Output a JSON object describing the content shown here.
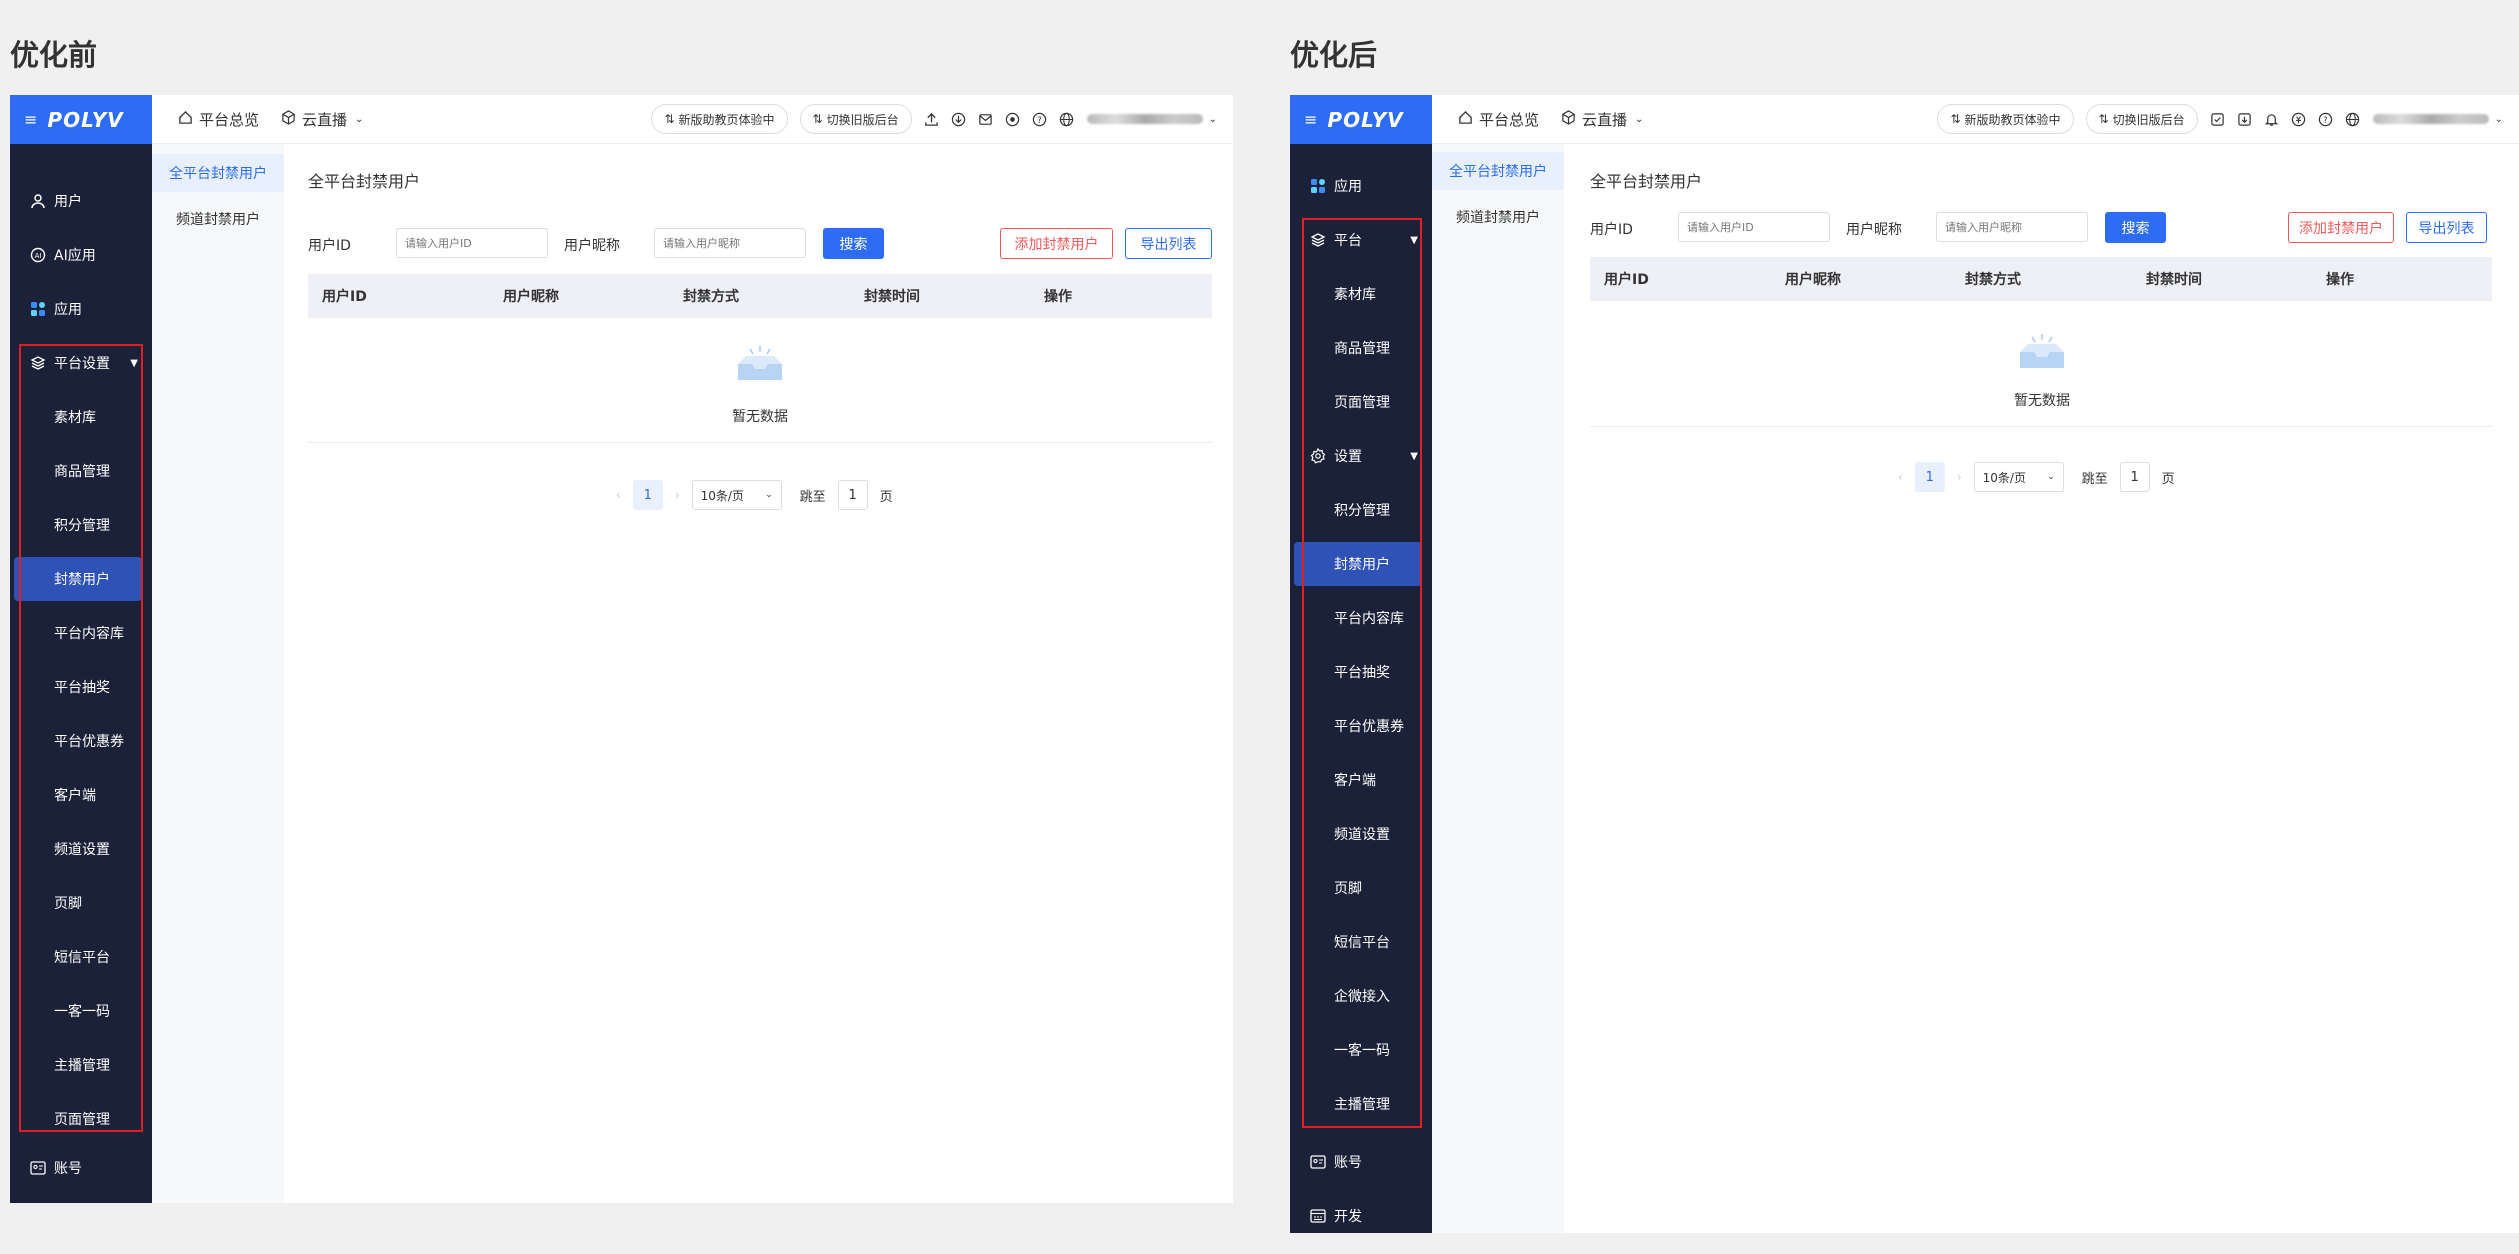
{
  "captions": {
    "before": "优化前",
    "after": "优化后"
  },
  "brand": {
    "logo": "POLYV",
    "menu_icon": "hamburger-icon",
    "accent": "#2e6cf5",
    "sidebar_bg": "#1a2138",
    "active_bg": "#2e52b5",
    "highlight": "#e02020"
  },
  "topbar": {
    "overview": "平台总览",
    "live": "云直播",
    "pill_new": "新版助教页体验中",
    "pill_switch": "切换旧版后台"
  },
  "before": {
    "sidebar": {
      "top": [
        {
          "label": "用户",
          "icon": "user-icon"
        },
        {
          "label": "AI应用",
          "icon": "ai-icon"
        },
        {
          "label": "应用",
          "icon": "apps-icon"
        }
      ],
      "group": {
        "label": "平台设置",
        "icon": "layers-icon"
      },
      "items": [
        "素材库",
        "商品管理",
        "积分管理",
        "封禁用户",
        "平台内容库",
        "平台抽奖",
        "平台优惠券",
        "客户端",
        "频道设置",
        "页脚",
        "短信平台",
        "一客一码",
        "主播管理",
        "页面管理"
      ],
      "active": "封禁用户",
      "bottom": {
        "label": "账号",
        "icon": "id-card-icon"
      }
    }
  },
  "after": {
    "sidebar": {
      "top": {
        "label": "应用",
        "icon": "apps-icon"
      },
      "group1": {
        "label": "平台",
        "icon": "layers-icon"
      },
      "group1_items": [
        "素材库",
        "商品管理",
        "页面管理"
      ],
      "group2": {
        "label": "设置",
        "icon": "gear-icon"
      },
      "group2_items": [
        "积分管理",
        "封禁用户",
        "平台内容库",
        "平台抽奖",
        "平台优惠券",
        "客户端",
        "频道设置",
        "页脚",
        "短信平台",
        "企微接入",
        "一客一码",
        "主播管理"
      ],
      "active": "封禁用户",
      "bottom": [
        {
          "label": "账号",
          "icon": "id-card-icon"
        },
        {
          "label": "开发",
          "icon": "dev-icon"
        }
      ]
    }
  },
  "subnav": [
    "全平台封禁用户",
    "频道封禁用户"
  ],
  "content": {
    "title": "全平台封禁用户",
    "filter_user_id": "用户ID",
    "filter_user_id_placeholder": "请输入用户ID",
    "filter_nickname": "用户昵称",
    "filter_nickname_placeholder": "请输入用户昵称",
    "search": "搜索",
    "add": "添加封禁用户",
    "export": "导出列表",
    "columns": [
      "用户ID",
      "用户昵称",
      "封禁方式",
      "封禁时间",
      "操作"
    ],
    "empty": "暂无数据",
    "pager": {
      "page": "1",
      "size": "10条/页",
      "jump_label": "跳至",
      "jump_value": "1",
      "page_unit": "页"
    }
  }
}
